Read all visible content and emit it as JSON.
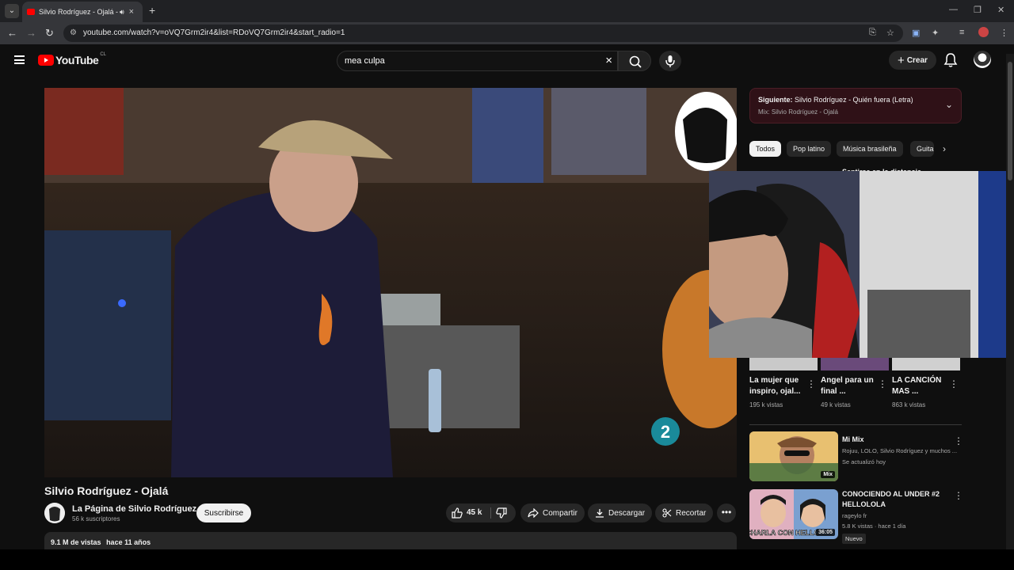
{
  "browser": {
    "tab_title": "Silvio Rodríguez - Ojalá - YouTube",
    "url": "youtube.com/watch?v=oVQ7Grm2ir4&list=RDoVQ7Grm2ir4&start_radio=1"
  },
  "header": {
    "logo_text": "YouTube",
    "country_code": "CL",
    "search_query": "mea culpa",
    "create_label": "Crear"
  },
  "video": {
    "title": "Silvio Rodríguez - Ojalá",
    "channel_name": "La Página de Silvio Rodríguez",
    "subscribers": "56 k suscriptores",
    "subscribe_label": "Suscribirse",
    "likes": "45 k",
    "share_label": "Compartir",
    "download_label": "Descargar",
    "clip_label": "Recortar",
    "views": "9.1 M de vistas",
    "age": "hace 11 años",
    "channel_bug_number": "2"
  },
  "sidebar": {
    "next_prefix": "Siguiente:",
    "next_title": "Silvio Rodríguez - Quién fuera (Letra)",
    "next_mix": "Mix: Silvio Rodríguez - Ojalá",
    "chips": [
      "Todos",
      "Pop latino",
      "Música brasileña",
      "Guita"
    ],
    "hidden_title": "Sentirse en la distancia",
    "shelf": [
      {
        "title": "La mujer que inspiro, ojal...",
        "views": "195 k vistas"
      },
      {
        "title": "Angel para un final ...",
        "views": "49 k vistas"
      },
      {
        "title": "LA CANCIÓN MAS ...",
        "views": "863 k vistas"
      }
    ],
    "items": [
      {
        "title": "Mi Mix",
        "channel": "Rojuu, LOLO, Silvio Rodríguez y muchos ...",
        "meta": "Se actualizó hoy",
        "badge": "Mix"
      },
      {
        "title": "CONOCIENDO AL UNDER #2 HELLOLOLA",
        "channel": "rageylo fr",
        "meta": "5.8 K vistas · hace 1 día",
        "duration": "36:05",
        "new_label": "Nuevo",
        "thumb_text": "CHARLA CON HELLO"
      }
    ]
  },
  "colors": {
    "background": "#0f0f0f",
    "brand_red": "#ff0000",
    "next_box": "#2f1117"
  },
  "icons": {
    "menu": "hamburger-icon",
    "search": "search-icon",
    "mic": "mic-icon",
    "bell": "bell-icon",
    "like": "thumbs-up-icon",
    "dislike": "thumbs-down-icon",
    "share": "share-icon",
    "download": "download-icon",
    "clip": "scissors-icon",
    "more": "more-horizontal-icon"
  }
}
